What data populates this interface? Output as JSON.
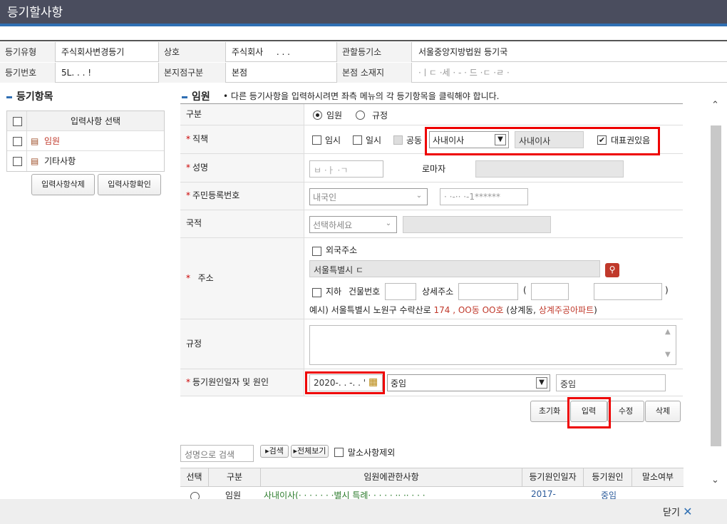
{
  "title": "등기할사항",
  "info": {
    "row1": {
      "l1": "등기유형",
      "v1": "주식회사변경등기",
      "l2": "상호",
      "v2": "주식회사 ㅤ . . .",
      "l3": "관할등기소",
      "v3": "서울중앙지방법원 등기국"
    },
    "row2": {
      "l1": "등기번호",
      "v1": "5L. . . !",
      "l2": "본지점구분",
      "v2": "본점",
      "l3": "본점 소재지",
      "v3": "·ㅣㄷ ·세 · - · 드 ·ㄷ ·ㄹ ·"
    }
  },
  "left": {
    "heading": "등기항목",
    "header": "입력사항 선택",
    "items": [
      {
        "label": "임원",
        "color": "#c0392b"
      },
      {
        "label": "기타사항",
        "color": "#222"
      }
    ],
    "btn_delete": "입력사항삭제",
    "btn_confirm": "입력사항확인"
  },
  "main": {
    "heading": "임원",
    "notice": "다른 등기사항을 입력하시려면 좌측 메뉴의 각 등기항목을 클릭해야 합니다.",
    "type_label": "구분",
    "type_opt1": "임원",
    "type_opt2": "규정",
    "pos_label": "직책",
    "pos_c1": "임시",
    "pos_c2": "일시",
    "pos_c3": "공동",
    "pos_select": "사내이사",
    "pos_value": "사내이사",
    "pos_rep": "대표권있음",
    "name_label": "성명",
    "name_value": "ㅂ ·ㅏ ·ㄱ",
    "roman_label": "로마자",
    "rrn_label": "주민등록번호",
    "rrn_select": "내국인",
    "rrn_value": "· ·-·· ·-1******",
    "nat_label": "국적",
    "nat_select": "선택하세요",
    "addr_label": "주소",
    "addr_foreign": "외국주소",
    "addr_value": "서울특별시 ㄷ",
    "addr_basement": "지하",
    "addr_bldg": "건물번호",
    "addr_detail": "상세주소",
    "addr_example_prefix": "예시) 서울특별시 노원구 수락산로",
    "addr_example_num": "174 , OO동 OO호",
    "addr_example_mid": "(상계동,",
    "addr_example_apt": "상계주공아파트",
    "addr_example_end": ")",
    "rule_label": "규정",
    "cause_label": "등기원인일자 및 원인",
    "cause_date": "2020-. . -. . '",
    "cause_select": "중임",
    "cause_value": "중임",
    "btn_reset": "초기화",
    "btn_input": "입력",
    "btn_edit": "수정",
    "btn_del": "삭제"
  },
  "search": {
    "placeholder": "성명으로 검색",
    "btn_search": "검색",
    "btn_all": "전체보기",
    "exclude": "말소사항제외"
  },
  "list": {
    "headers": [
      "선택",
      "구분",
      "임원에관한사항",
      "등기원인일자",
      "등기원인",
      "말소여부"
    ],
    "row": {
      "type": "임원",
      "desc": "사내이사(· · · · · · ·별시 특례· · · · · ·· ·· · · ·",
      "date": "2017-",
      "cause": "중임"
    }
  },
  "footer": {
    "close": "닫기"
  }
}
